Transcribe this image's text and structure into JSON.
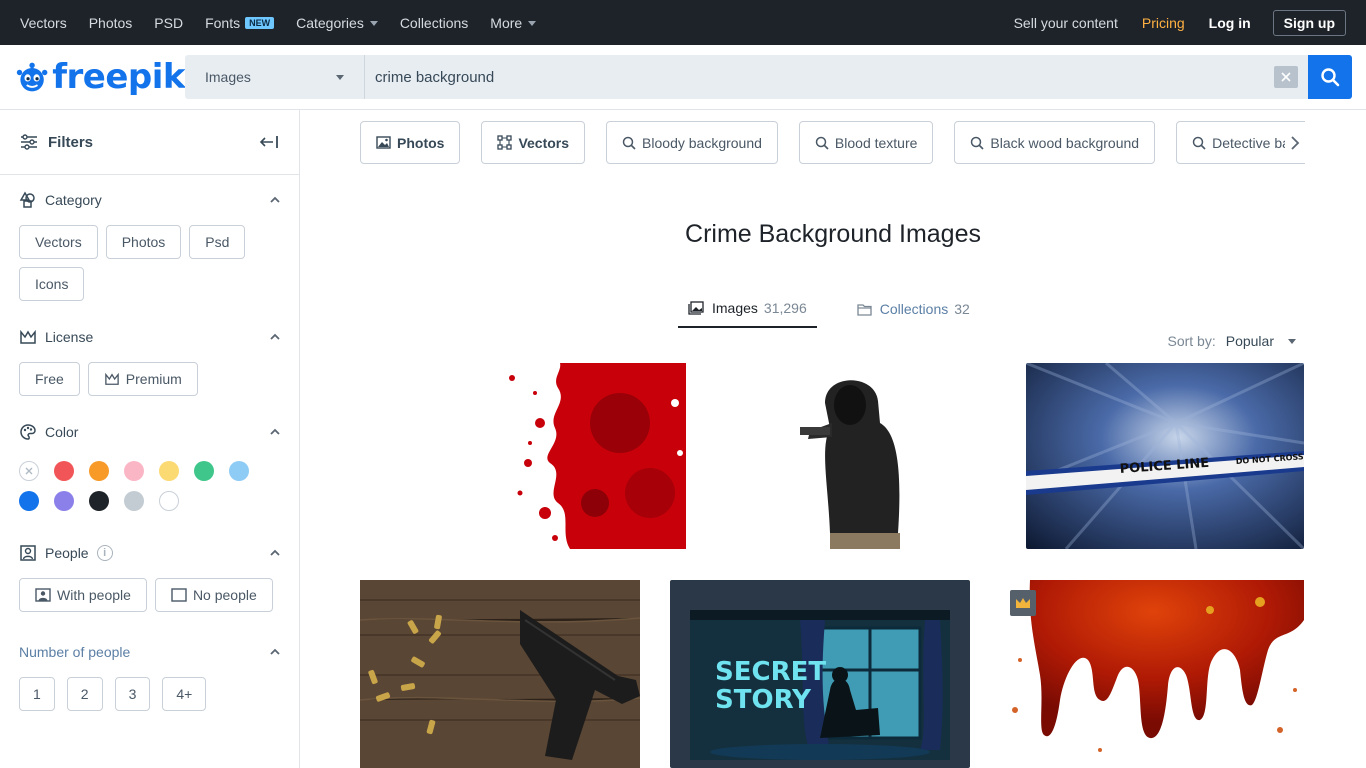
{
  "topnav": {
    "items": [
      {
        "label": "Vectors"
      },
      {
        "label": "Photos"
      },
      {
        "label": "PSD"
      },
      {
        "label": "Fonts",
        "badge": "NEW"
      },
      {
        "label": "Categories"
      },
      {
        "label": "Collections"
      },
      {
        "label": "More"
      }
    ],
    "sell": "Sell your content",
    "pricing": "Pricing",
    "login": "Log in",
    "signup": "Sign up"
  },
  "logo": {
    "text": "freepik"
  },
  "search": {
    "type": "Images",
    "query": "crime background"
  },
  "sidebar": {
    "title": "Filters",
    "category": {
      "label": "Category",
      "chips": [
        "Vectors",
        "Photos",
        "Psd",
        "Icons"
      ]
    },
    "license": {
      "label": "License",
      "chips": [
        "Free",
        "Premium"
      ]
    },
    "color": {
      "label": "Color",
      "swatches": [
        "#ffffff",
        "#f25557",
        "#f79a28",
        "#fbb6c6",
        "#fbd973",
        "#3fc68a",
        "#8ecbf5",
        "#1273eb",
        "#8b7fea",
        "#1e2329",
        "#c3cbd3",
        "#ffffff"
      ]
    },
    "people": {
      "label": "People",
      "info": "i",
      "chips": [
        "With people",
        "No people"
      ]
    },
    "number_of_people": {
      "label": "Number of people",
      "chips": [
        "1",
        "2",
        "3",
        "4+"
      ]
    }
  },
  "tags": [
    {
      "label": "Photos",
      "icon": "image-icon",
      "bold": true
    },
    {
      "label": "Vectors",
      "icon": "vector-icon",
      "bold": true
    },
    {
      "label": "Bloody background",
      "icon": "search-icon"
    },
    {
      "label": "Blood texture",
      "icon": "search-icon"
    },
    {
      "label": "Black wood background",
      "icon": "search-icon"
    },
    {
      "label": "Detective background",
      "icon": "search-icon"
    }
  ],
  "page_title": "Crime Background Images",
  "tabs": [
    {
      "label": "Images",
      "count": "31,296"
    },
    {
      "label": "Collections",
      "count": "32"
    }
  ],
  "sort": {
    "label": "Sort by:",
    "value": "Popular"
  },
  "thumbs": {
    "police_text_1": "POLICE LINE",
    "police_text_2": "DO NOT CROSS",
    "secret_1": "SECRET",
    "secret_2": "STORY"
  },
  "colors": {
    "brand": "#1273eb",
    "nav_bg": "#1e2329",
    "pricing": "#ffb142"
  }
}
